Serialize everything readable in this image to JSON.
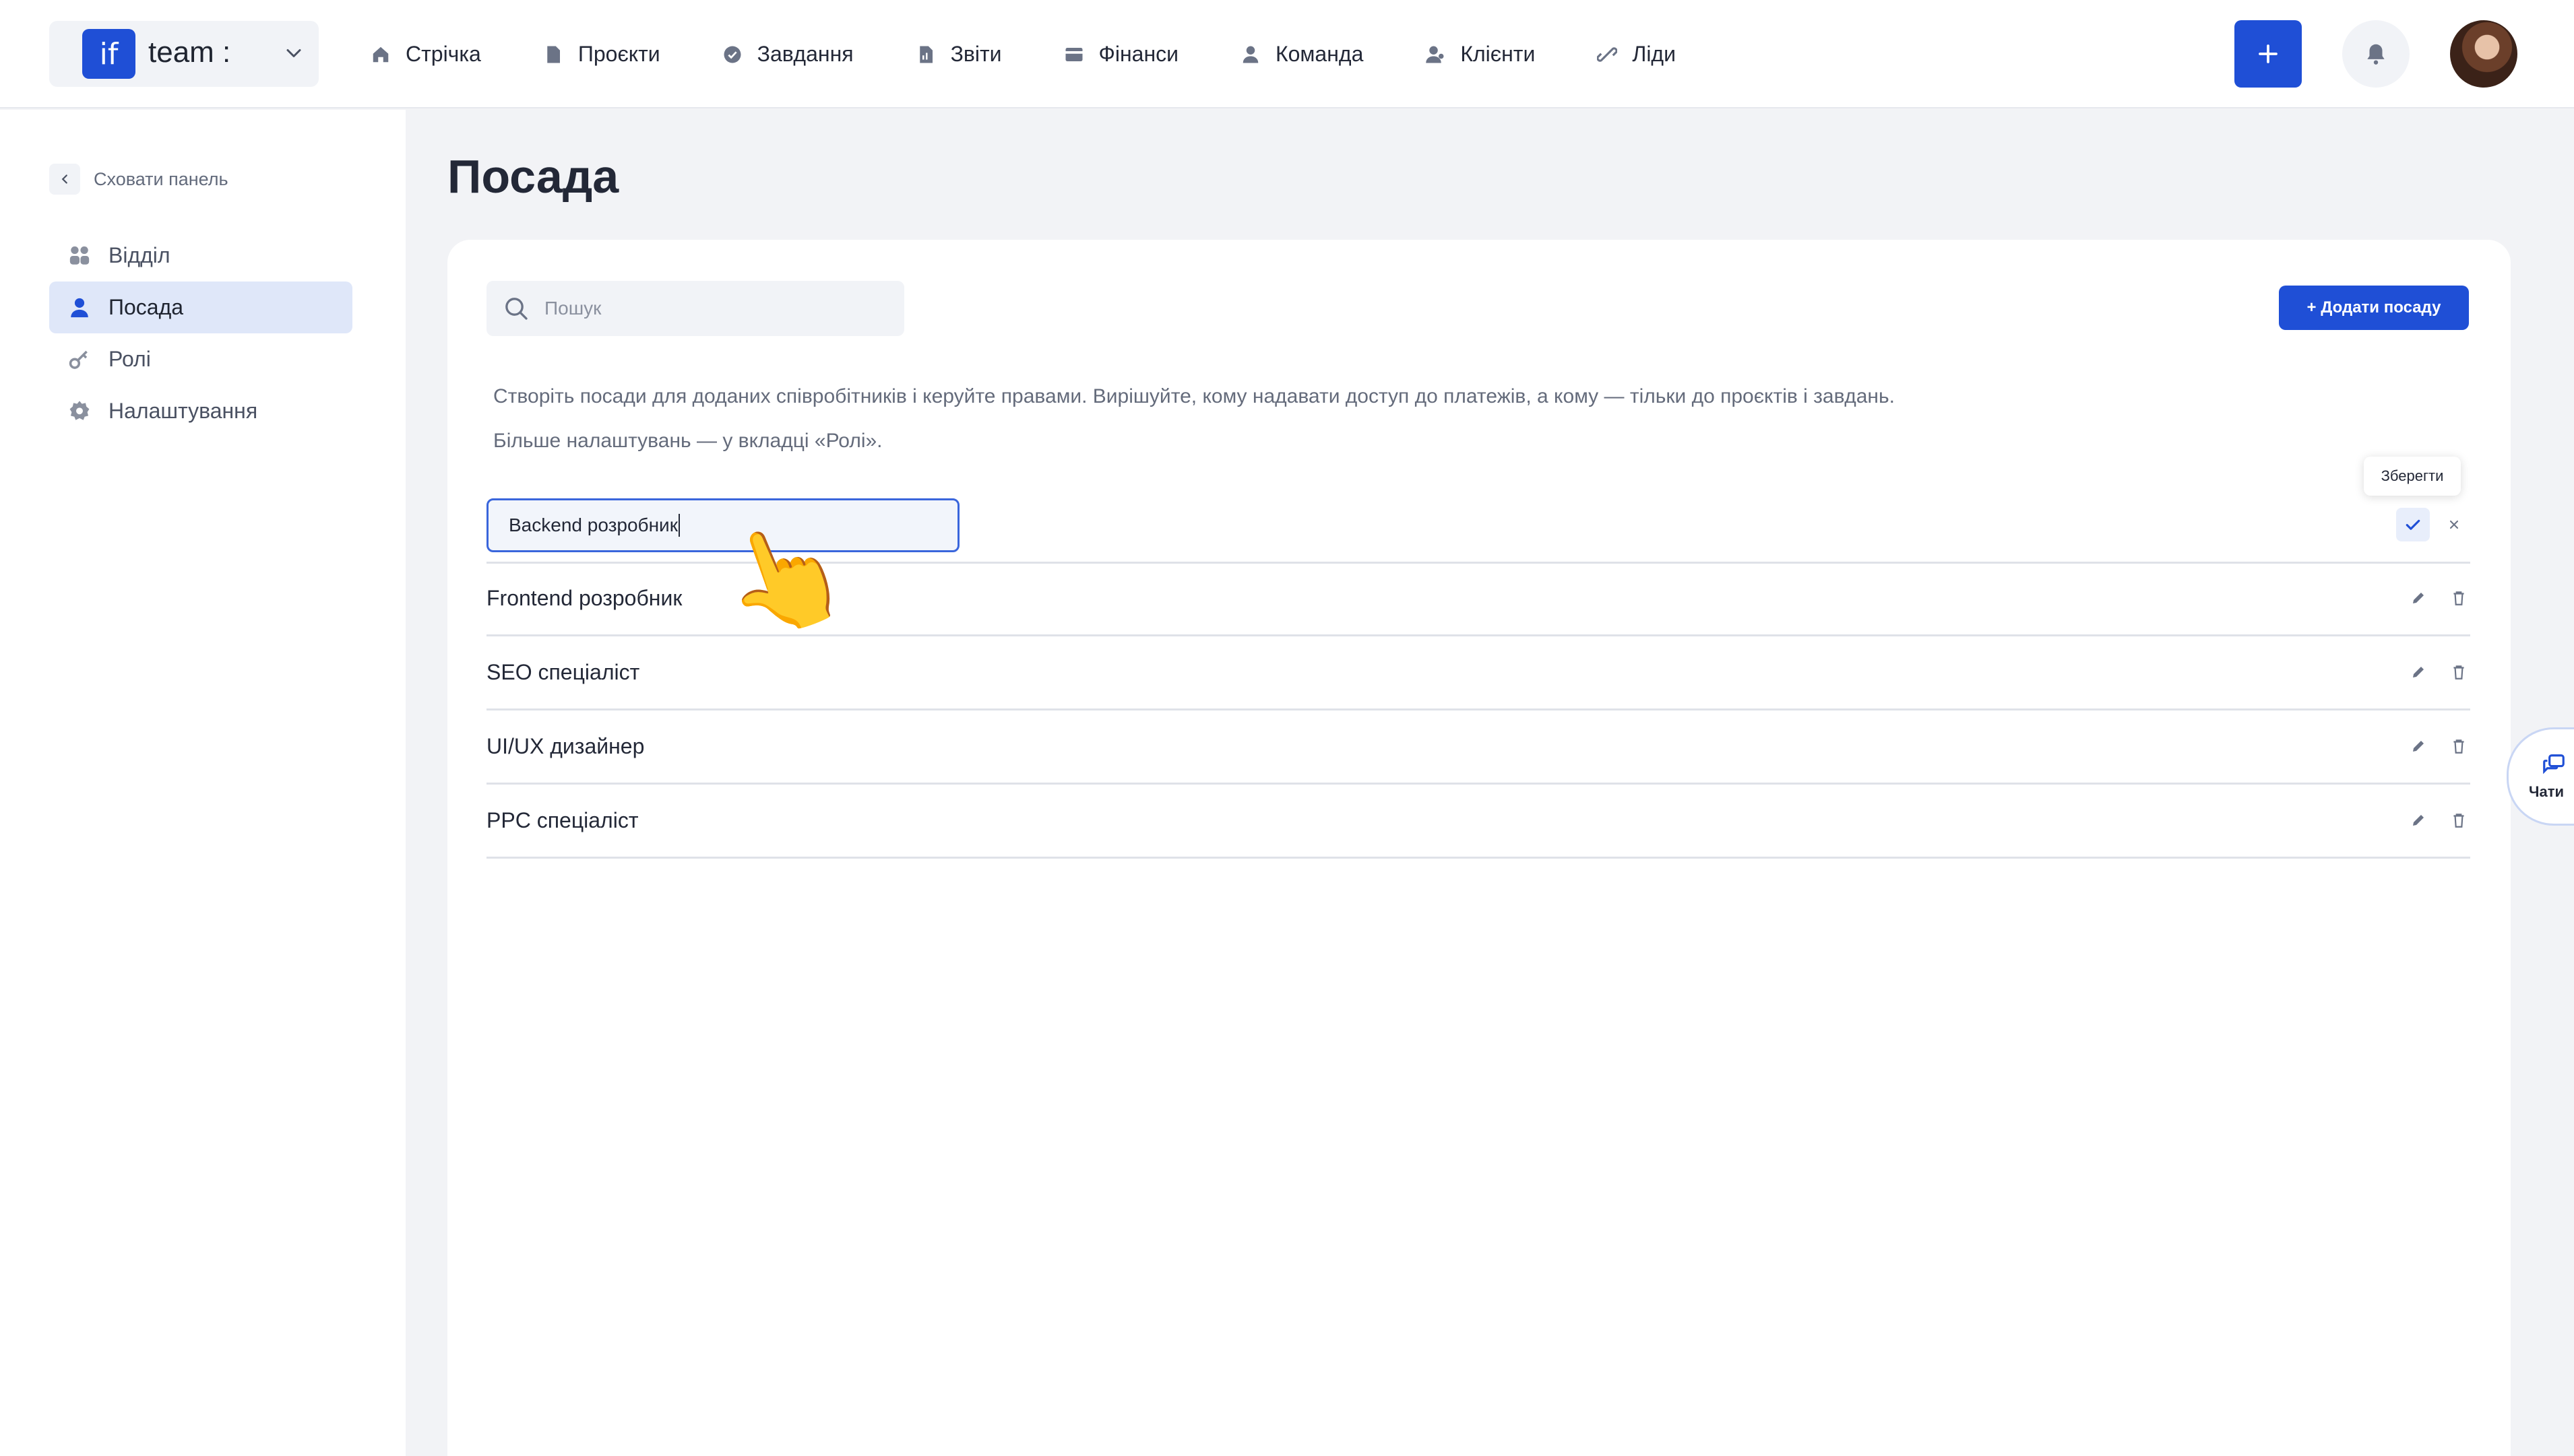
{
  "brand": {
    "logo_text": "if",
    "name": "team :"
  },
  "nav": [
    {
      "label": "Стрічка",
      "icon": "home-icon"
    },
    {
      "label": "Проєкти",
      "icon": "document-icon"
    },
    {
      "label": "Завдання",
      "icon": "check-circle-icon"
    },
    {
      "label": "Звіти",
      "icon": "report-icon"
    },
    {
      "label": "Фінанси",
      "icon": "wallet-icon"
    },
    {
      "label": "Команда",
      "icon": "user-icon"
    },
    {
      "label": "Клієнти",
      "icon": "clients-icon"
    },
    {
      "label": "Ліди",
      "icon": "leads-icon"
    }
  ],
  "sidebar": {
    "hide_label": "Сховати панель",
    "items": [
      {
        "label": "Відділ",
        "icon": "department-icon"
      },
      {
        "label": "Посада",
        "icon": "position-icon",
        "active": true
      },
      {
        "label": "Ролі",
        "icon": "key-icon"
      },
      {
        "label": "Налаштування",
        "icon": "gear-icon"
      }
    ]
  },
  "page": {
    "title": "Посада",
    "search_placeholder": "Пошук",
    "add_button": "+ Додати посаду",
    "description_line1": "Створіть посади для доданих співробітників і керуйте правами. Вирішуйте, кому надавати доступ до платежів, а кому — тільки до проєктів і завдань.",
    "description_line2": "Більше налаштувань — у вкладці «Ролі».",
    "save_tooltip": "Зберегти",
    "editing_value": "Backend розробник",
    "positions": [
      "Frontend розробник",
      "SEO спеціаліст",
      "UI/UX дизайнер",
      "PPC спеціаліст"
    ]
  },
  "chats": {
    "label": "Чати"
  },
  "colors": {
    "accent": "#1f4fd6",
    "active_bg": "#dfe7f9",
    "page_bg": "#f2f3f6"
  }
}
